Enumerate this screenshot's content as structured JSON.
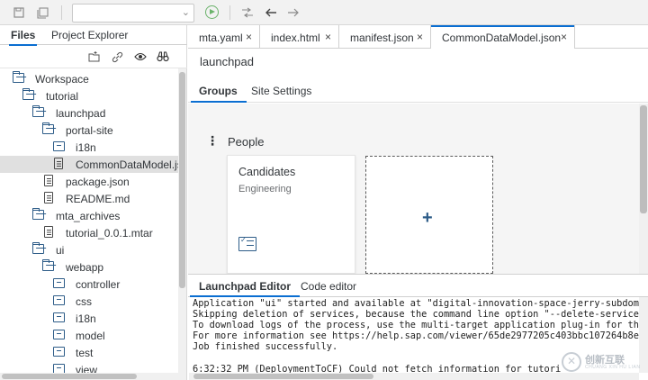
{
  "toolbar": {
    "icons": [
      "save-icon",
      "save-all-icon",
      "run-icon",
      "git-compare-icon",
      "back-arrow-icon",
      "forward-arrow-icon"
    ],
    "run_color": "#6bb36b"
  },
  "left_panel": {
    "tabs": [
      {
        "label": "Files"
      },
      {
        "label": "Project Explorer"
      }
    ],
    "tools": [
      "new-folder-icon",
      "link-icon",
      "eye-icon",
      "binoculars-icon"
    ],
    "tree": [
      {
        "label": "Workspace",
        "icon": "folder-open-icon"
      },
      {
        "label": "tutorial",
        "icon": "folder-open-icon"
      },
      {
        "label": "launchpad",
        "icon": "folder-open-icon"
      },
      {
        "label": "portal-site",
        "icon": "folder-open-icon"
      },
      {
        "label": "i18n",
        "icon": "folder-closed-icon"
      },
      {
        "label": "CommonDataModel.json",
        "icon": "file-icon"
      },
      {
        "label": "package.json",
        "icon": "file-icon"
      },
      {
        "label": "README.md",
        "icon": "file-icon"
      },
      {
        "label": "mta_archives",
        "icon": "folder-open-icon"
      },
      {
        "label": "tutorial_0.0.1.mtar",
        "icon": "file-icon"
      },
      {
        "label": "ui",
        "icon": "folder-open-icon"
      },
      {
        "label": "webapp",
        "icon": "folder-open-icon"
      },
      {
        "label": "controller",
        "icon": "folder-closed-icon"
      },
      {
        "label": "css",
        "icon": "folder-closed-icon"
      },
      {
        "label": "i18n",
        "icon": "folder-closed-icon"
      },
      {
        "label": "model",
        "icon": "folder-closed-icon"
      },
      {
        "label": "test",
        "icon": "folder-closed-icon"
      },
      {
        "label": "view",
        "icon": "folder-closed-icon"
      }
    ]
  },
  "editor_tabs": [
    {
      "label": "mta.yaml",
      "close": "×"
    },
    {
      "label": "index.html",
      "close": "×"
    },
    {
      "label": "manifest.json",
      "close": "×"
    },
    {
      "label": "CommonDataModel.json",
      "close": "×"
    }
  ],
  "editor": {
    "title": "launchpad",
    "tabs": [
      {
        "label": "Groups"
      },
      {
        "label": "Site Settings"
      }
    ],
    "group": {
      "menu": "⋮",
      "name": "People",
      "tile": {
        "title": "Candidates",
        "subtitle": "Engineering"
      },
      "add_symbol": "+"
    }
  },
  "bottom_panel": {
    "tabs": [
      {
        "label": "Launchpad Editor"
      },
      {
        "label": "Code editor"
      }
    ],
    "console_lines": [
      "Application \"ui\" started and available at \"digital-innovation-space-jerry-subdoma",
      "Skipping deletion of services, because the command line option \"--delete-services",
      "To download logs of the process, use the multi-target application plug-in for the",
      "For more information see https://help.sap.com/viewer/65de2977205c403bbc107264b8e",
      "Job finished successfully.",
      "",
      "6:32:32 PM (DeploymentToCF) Could not fetch information for tutori"
    ]
  },
  "watermark": {
    "text": "创新互联",
    "sub": "CHUANG XIN HU LIAN"
  },
  "colors": {
    "accent": "#0a6ed1",
    "folder": "#2d5c88"
  }
}
